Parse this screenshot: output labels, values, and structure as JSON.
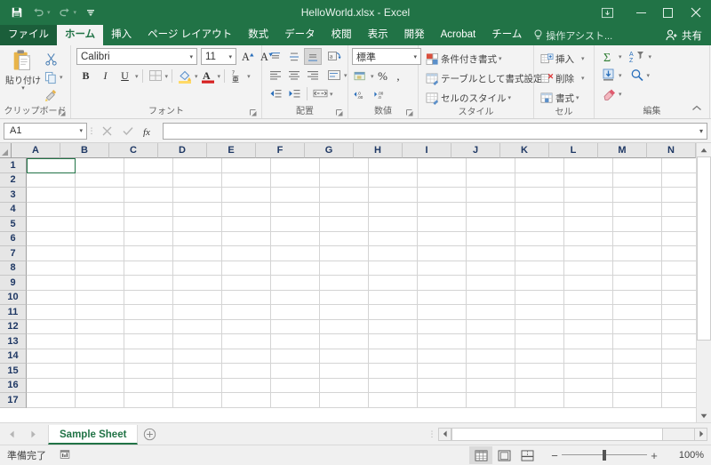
{
  "titlebar": {
    "document_title": "HelloWorld.xlsx - Excel",
    "qat": [
      {
        "name": "save",
        "label": "保存"
      },
      {
        "name": "undo",
        "label": "元に戻す"
      },
      {
        "name": "redo",
        "label": "やり直し"
      },
      {
        "name": "customize",
        "label": "クイック アクセス ツール バーのユーザー設定"
      }
    ],
    "ribbon_display_options_label": "リボンの表示オプション",
    "minimize_label": "最小化",
    "maximize_label": "最大化",
    "close_label": "閉じる",
    "accent_color": "#217346"
  },
  "tabs": {
    "file": "ファイル",
    "items": [
      "ホーム",
      "挿入",
      "ページ レイアウト",
      "数式",
      "データ",
      "校閲",
      "表示",
      "開発",
      "Acrobat",
      "チーム"
    ],
    "active": "ホーム",
    "tell_me": "操作アシスト...",
    "share": "共有"
  },
  "ribbon": {
    "groups": [
      {
        "name": "clipboard",
        "label": "クリップボード",
        "paste_label": "貼り付け",
        "items": [
          "切り取り",
          "コピー",
          "書式のコピー/貼り付け"
        ]
      },
      {
        "name": "font",
        "label": "フォント",
        "font_name": "Calibri",
        "font_size": "11",
        "items": [
          "フォント サイズの拡大",
          "フォント サイズの縮小",
          "太字",
          "斜体",
          "下線",
          "罫線",
          "塗りつぶしの色",
          "フォントの色",
          "ふりがなの表示/非表示"
        ],
        "bold": "B",
        "italic": "I",
        "underline": "U"
      },
      {
        "name": "alignment",
        "label": "配置",
        "items": [
          "上揃え",
          "上下中央揃え",
          "下揃え",
          "方向",
          "左揃え",
          "中央揃え",
          "右揃え",
          "折り返して全体を表示する",
          "インデントを減らす",
          "インデントを増やす",
          "セルを結合して中央揃え"
        ]
      },
      {
        "name": "number",
        "label": "数値",
        "format": "標準",
        "items": [
          "通貨表示形式",
          "パーセント スタイル",
          "桁区切りスタイル",
          "小数点以下の表示桁数を増やす",
          "小数点以下の表示桁数を減らす"
        ]
      },
      {
        "name": "styles",
        "label": "スタイル",
        "items": [
          "条件付き書式",
          "テーブルとして書式設定",
          "セルのスタイル"
        ]
      },
      {
        "name": "cells",
        "label": "セル",
        "items": [
          "挿入",
          "削除",
          "書式"
        ]
      },
      {
        "name": "editing",
        "label": "編集",
        "items": [
          "合計",
          "並べ替えとフィルター",
          "フィル",
          "検索と選択",
          "クリア"
        ]
      }
    ],
    "collapse_label": "リボンを折りたたむ"
  },
  "formula_bar": {
    "name_box_value": "A1",
    "cancel_label": "キャンセル",
    "enter_label": "入力",
    "insert_function_label": "関数の挿入",
    "formula_value": "",
    "expand_label": "数式バーの展開"
  },
  "grid": {
    "columns": [
      "A",
      "B",
      "C",
      "D",
      "E",
      "F",
      "G",
      "H",
      "I",
      "J",
      "K",
      "L",
      "M",
      "N"
    ],
    "rows": [
      1,
      2,
      3,
      4,
      5,
      6,
      7,
      8,
      9,
      10,
      11,
      12,
      13,
      14,
      15,
      16,
      17
    ],
    "selected_cell": "A1",
    "select_all_label": "すべて選択"
  },
  "sheet_bar": {
    "prev_label": "前のシート",
    "next_label": "次のシート",
    "sheets": [
      {
        "name": "Sample Sheet",
        "active": true
      }
    ],
    "add_sheet_label": "新しいシート"
  },
  "status_bar": {
    "status_text": "準備完了",
    "macro_label": "マクロの記録",
    "views": [
      {
        "name": "normal",
        "label": "標準",
        "active": true
      },
      {
        "name": "page-layout",
        "label": "ページ レイアウト",
        "active": false
      },
      {
        "name": "page-break",
        "label": "改ページ プレビュー",
        "active": false
      }
    ],
    "zoom_out_label": "縮小",
    "zoom_in_label": "拡大",
    "zoom_level": "100%"
  }
}
